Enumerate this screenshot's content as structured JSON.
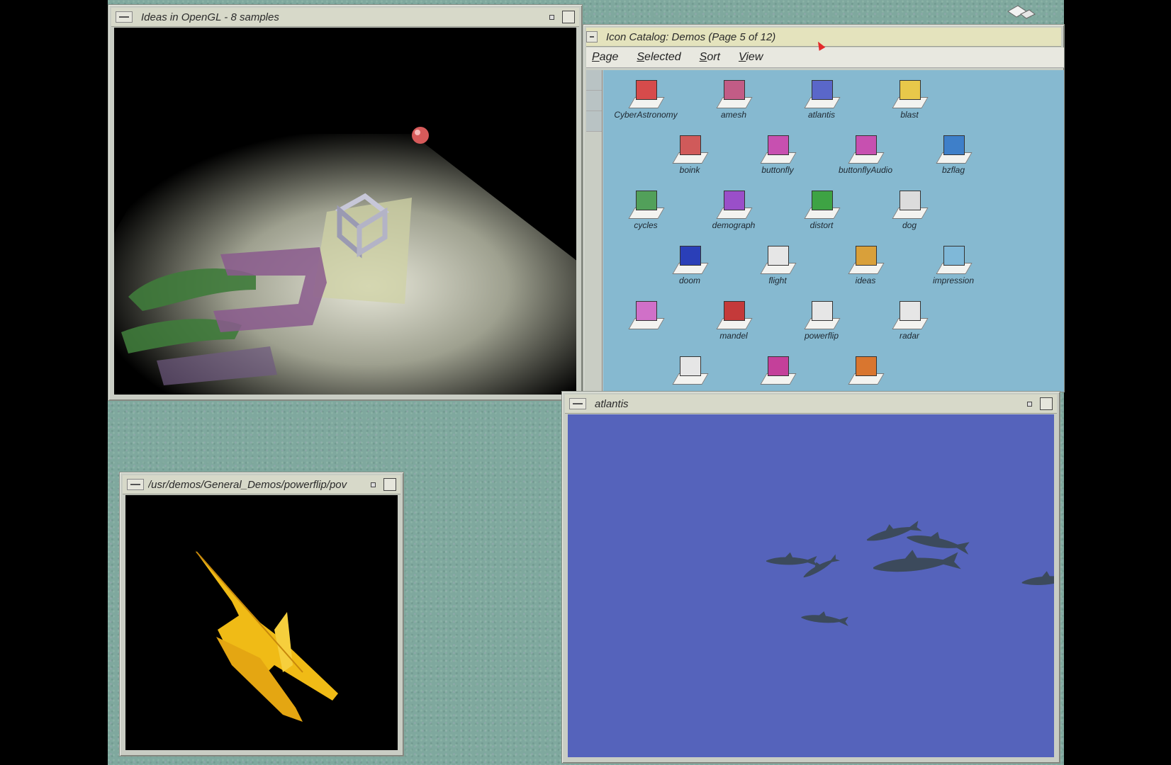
{
  "windows": {
    "ideas": {
      "title": "Ideas in OpenGL - 8 samples"
    },
    "catalog": {
      "title": "Icon Catalog: Demos (Page 5 of 12)",
      "menu": [
        "Page",
        "Selected",
        "Sort",
        "View"
      ],
      "icons": [
        {
          "label": "CyberAstronomy",
          "color": "#d64b4b"
        },
        {
          "label": "amesh",
          "color": "#c25c86"
        },
        {
          "label": "atlantis",
          "color": "#5a67c9"
        },
        {
          "label": "blast",
          "color": "#e8c84a"
        },
        {
          "label": "boink",
          "color": "#d05a5a"
        },
        {
          "label": "buttonfly",
          "color": "#c750b0"
        },
        {
          "label": "buttonflyAudio",
          "color": "#c750b0"
        },
        {
          "label": "bzflag",
          "color": "#3e7fc9"
        },
        {
          "label": "cycles",
          "color": "#52a05a"
        },
        {
          "label": "demograph",
          "color": "#9a4fc9"
        },
        {
          "label": "distort",
          "color": "#3ea344"
        },
        {
          "label": "dog",
          "color": "#dcdcdc"
        },
        {
          "label": "doom",
          "color": "#2a3fb8"
        },
        {
          "label": "flight",
          "color": "#e6e6e6"
        },
        {
          "label": "ideas",
          "color": "#d9a03a"
        },
        {
          "label": "impression",
          "color": "#7fb8d8"
        },
        {
          "label": "",
          "color": "#d070c8"
        },
        {
          "label": "mandel",
          "color": "#c43a3a"
        },
        {
          "label": "powerflip",
          "color": "#e6e6e6"
        },
        {
          "label": "radar",
          "color": "#e6e6e6"
        },
        {
          "label": "",
          "color": "#e6e6e6"
        },
        {
          "label": "",
          "color": "#c4409a"
        },
        {
          "label": "",
          "color": "#d9762f"
        }
      ]
    },
    "powerflip": {
      "title": "/usr/demos/General_Demos/powerflip/pov"
    },
    "atlantis": {
      "title": "atlantis"
    }
  },
  "colors": {
    "desktop": "#7fa89e",
    "atlantis_ocean": "#5563bb",
    "catalog_bg": "#86b9d0",
    "plane": "#f2c21b"
  }
}
